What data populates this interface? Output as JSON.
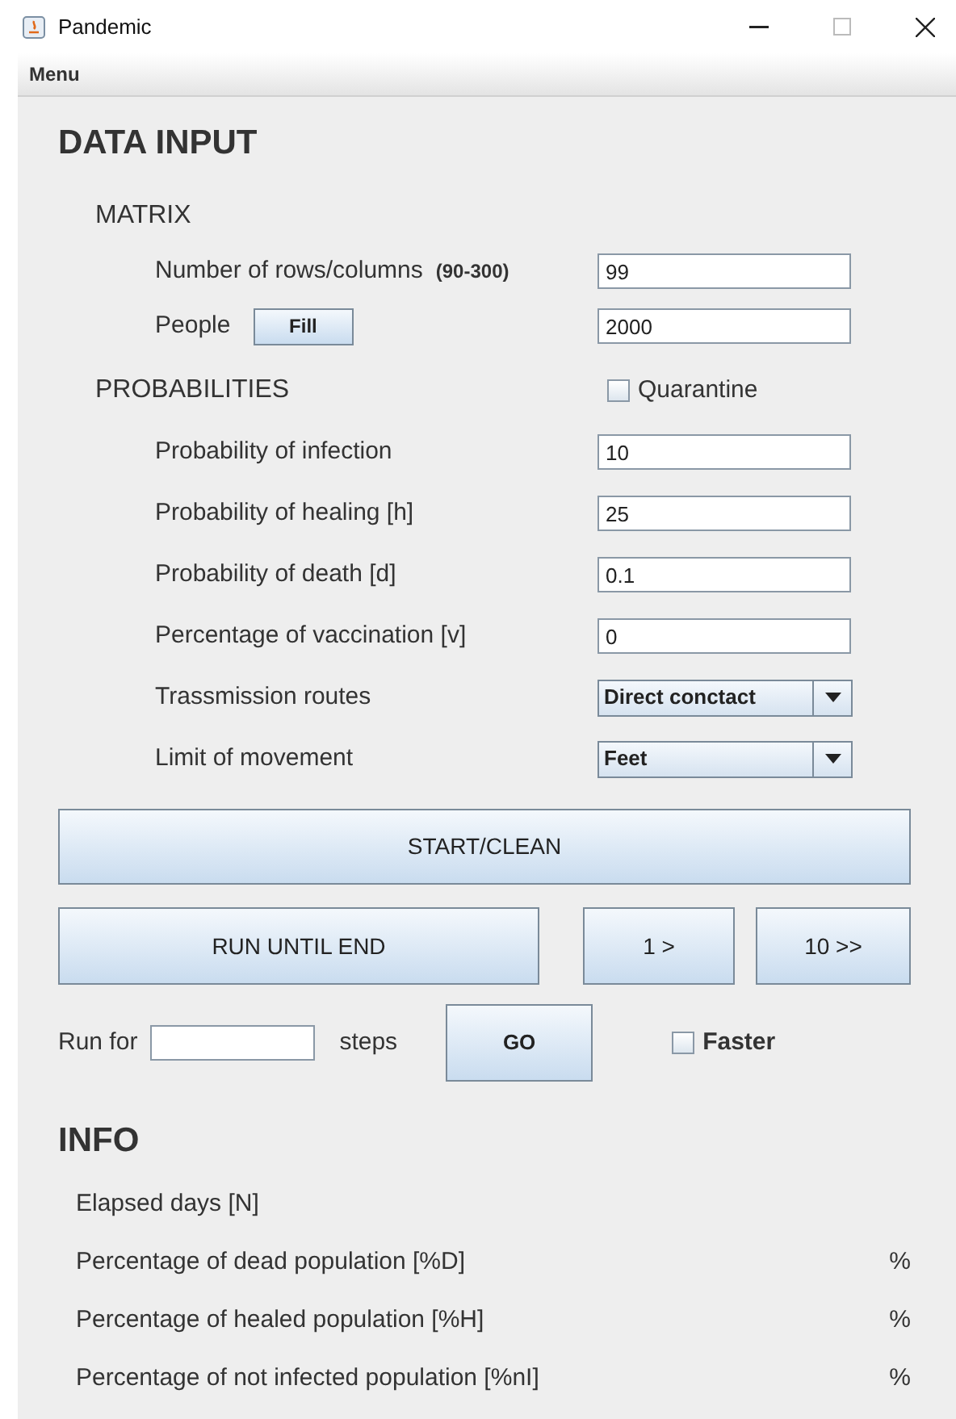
{
  "window": {
    "title": "Pandemic"
  },
  "menu_bar": [
    "Menu"
  ],
  "data_input": {
    "title": "DATA INPUT",
    "matrix": {
      "title": "MATRIX",
      "rows_columns": {
        "label": "Number of rows/columns",
        "hint": "(90-300)",
        "value": "99"
      },
      "people": {
        "label": "People",
        "button": "Fill",
        "value": "2000"
      }
    },
    "probabilities": {
      "title": "PROBABILITIES",
      "quarantine": {
        "label": "Quarantine",
        "checked": false
      },
      "fields": [
        {
          "kind": "text",
          "label": "Probability of infection",
          "value": "10"
        },
        {
          "kind": "text",
          "label": "Probability of healing [h]",
          "value": "25"
        },
        {
          "kind": "text",
          "label": "Probability of death [d]",
          "value": "0.1"
        },
        {
          "kind": "text",
          "label": "Percentage of vaccination [v]",
          "value": "0"
        },
        {
          "kind": "combo",
          "label": "Trassmission routes",
          "value": "Direct conctact"
        },
        {
          "kind": "combo",
          "label": "Limit of movement",
          "value": "Feet"
        }
      ]
    }
  },
  "controls": {
    "start": "START/CLEAN",
    "run_until_end": "RUN UNTIL END",
    "step_one": "1 >",
    "step_ten": "10 >>",
    "run_for": {
      "label": "Run for",
      "unit": "steps",
      "button": "GO"
    },
    "faster": {
      "label": "Faster",
      "checked": false
    }
  },
  "info": {
    "title": "INFO",
    "rows": [
      {
        "label": "Elapsed days [N]"
      },
      {
        "label": "Percentage of dead population [%D]",
        "unit": "%"
      },
      {
        "label": "Percentage of healed population [%H]",
        "unit": "%"
      },
      {
        "label": "Percentage of not infected population [%nI]",
        "unit": "%"
      }
    ]
  }
}
